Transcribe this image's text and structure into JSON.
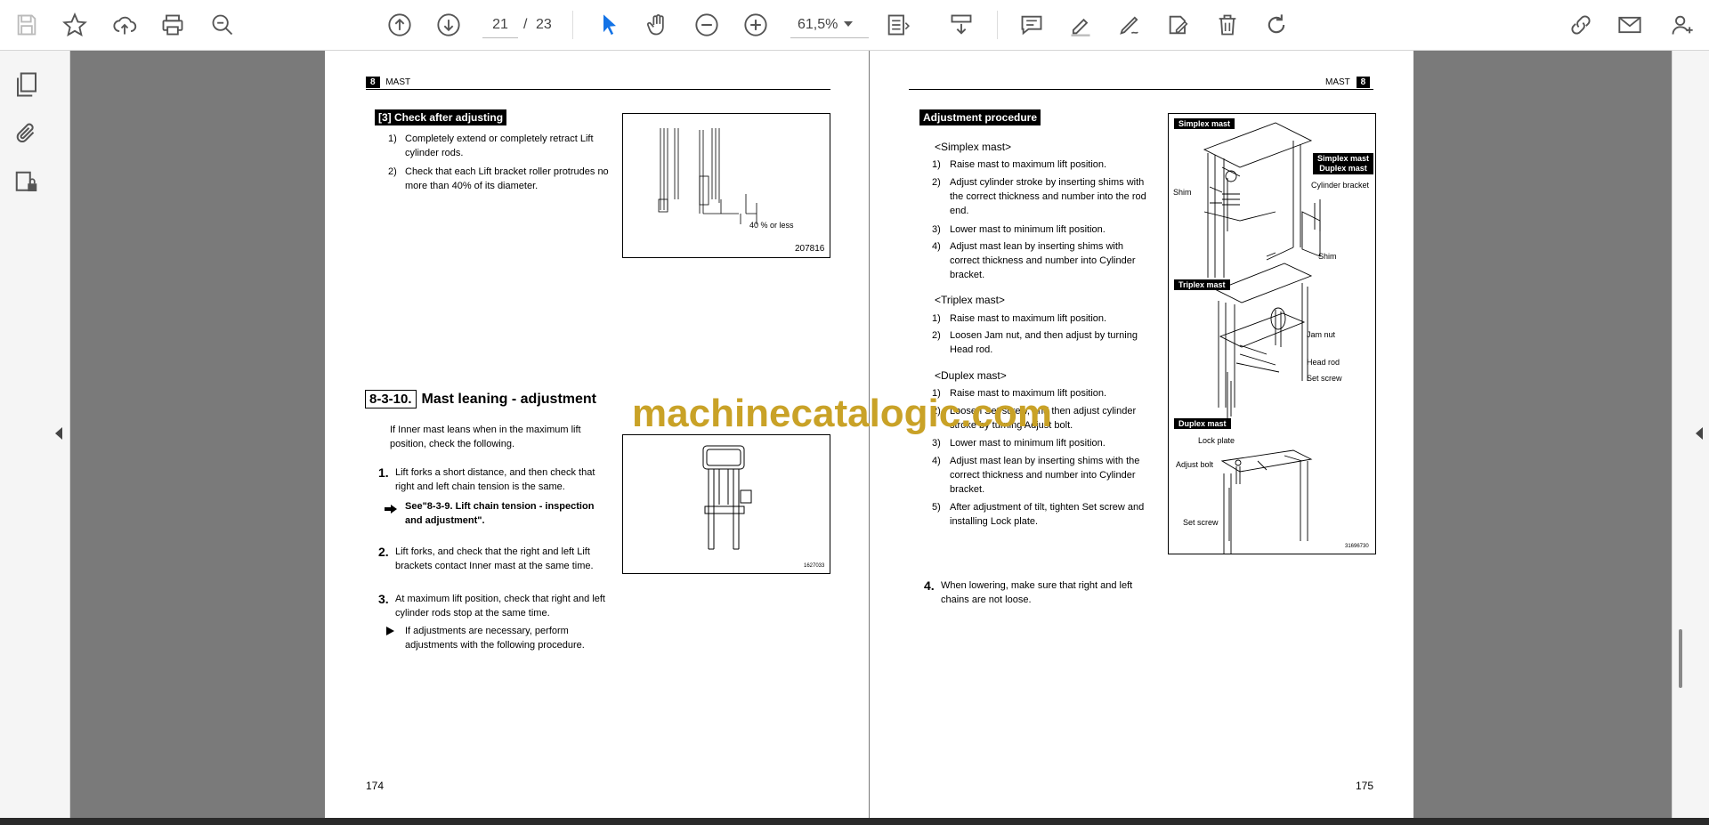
{
  "toolbar": {
    "current_page": "21",
    "page_separator": "/",
    "total_pages": "23",
    "zoom": "61,5%"
  },
  "watermark": "machinecatalogic.com",
  "left_page": {
    "header_num": "8",
    "header_title": "MAST",
    "section3_title": "[3] Check after adjusting",
    "section3_items": [
      {
        "n": "1)",
        "text": "Completely extend or completely retract Lift cylinder rods."
      },
      {
        "n": "2)",
        "text": "Check that each Lift bracket roller protrudes no more than 40% of its diameter."
      }
    ],
    "fig1_label": "40 % or less",
    "fig1_code": "207816",
    "section_num": "8-3-10.",
    "section_title": "Mast leaning - adjustment",
    "intro": "If Inner mast leans when in the maximum lift position, check the following.",
    "step1_n": "1.",
    "step1": "Lift forks a short distance, and then check that right and left chain tension is the same.",
    "see_ref": "See\"8-3-9. Lift chain tension - inspection and adjustment\".",
    "step2_n": "2.",
    "step2": "Lift forks, and check that the right and left Lift brackets contact Inner mast at the same time.",
    "step3_n": "3.",
    "step3": "At maximum lift position, check that right and left cylinder rods stop at the same time.",
    "note": "If adjustments are necessary, perform adjustments with the following procedure.",
    "fig2_code": "1627033",
    "page_number": "174"
  },
  "right_page": {
    "header_num": "8",
    "header_title": "MAST",
    "proc_title": "Adjustment procedure",
    "simplex_title": "<Simplex mast>",
    "simplex_items": [
      {
        "n": "1)",
        "text": "Raise mast to maximum lift position."
      },
      {
        "n": "2)",
        "text": "Adjust cylinder stroke by inserting shims with the correct thickness and number into the rod end."
      },
      {
        "n": "3)",
        "text": "Lower mast to minimum lift position."
      },
      {
        "n": "4)",
        "text": "Adjust mast lean by inserting shims with correct thickness and number into Cylinder bracket."
      }
    ],
    "triplex_title": "<Triplex mast>",
    "triplex_items": [
      {
        "n": "1)",
        "text": "Raise mast to maximum lift position."
      },
      {
        "n": "2)",
        "text": "Loosen Jam nut, and then adjust by turning Head rod."
      }
    ],
    "duplex_title": "<Duplex mast>",
    "duplex_items": [
      {
        "n": "1)",
        "text": "Raise mast to maximum lift position."
      },
      {
        "n": "2)",
        "text": "Loosen Set screw, and then adjust cylinder stroke by turning Adjust bolt."
      },
      {
        "n": "3)",
        "text": "Lower mast to minimum lift position."
      },
      {
        "n": "4)",
        "text": "Adjust mast lean by inserting shims with the correct thickness and number into Cylinder bracket."
      },
      {
        "n": "5)",
        "text": "After adjustment of tilt, tighten Set screw and installing Lock plate."
      }
    ],
    "step4_n": "4.",
    "step4": "When lowering, make sure that right and left chains are not loose.",
    "fig": {
      "simplex_label": "Simplex mast",
      "simplex_duplex_line1": "Simplex mast",
      "simplex_duplex_line2": "Duplex mast",
      "shim1": "Shim",
      "cylinder_bracket": "Cylinder bracket",
      "shim2": "Shim",
      "triplex_label": "Triplex mast",
      "jam_nut": "Jam nut",
      "head_rod": "Head rod",
      "set_screw1": "Set screw",
      "duplex_label": "Duplex mast",
      "lock_plate": "Lock plate",
      "adjust_bolt": "Adjust bolt",
      "set_screw2": "Set screw",
      "code": "31696730"
    },
    "page_number": "175"
  }
}
